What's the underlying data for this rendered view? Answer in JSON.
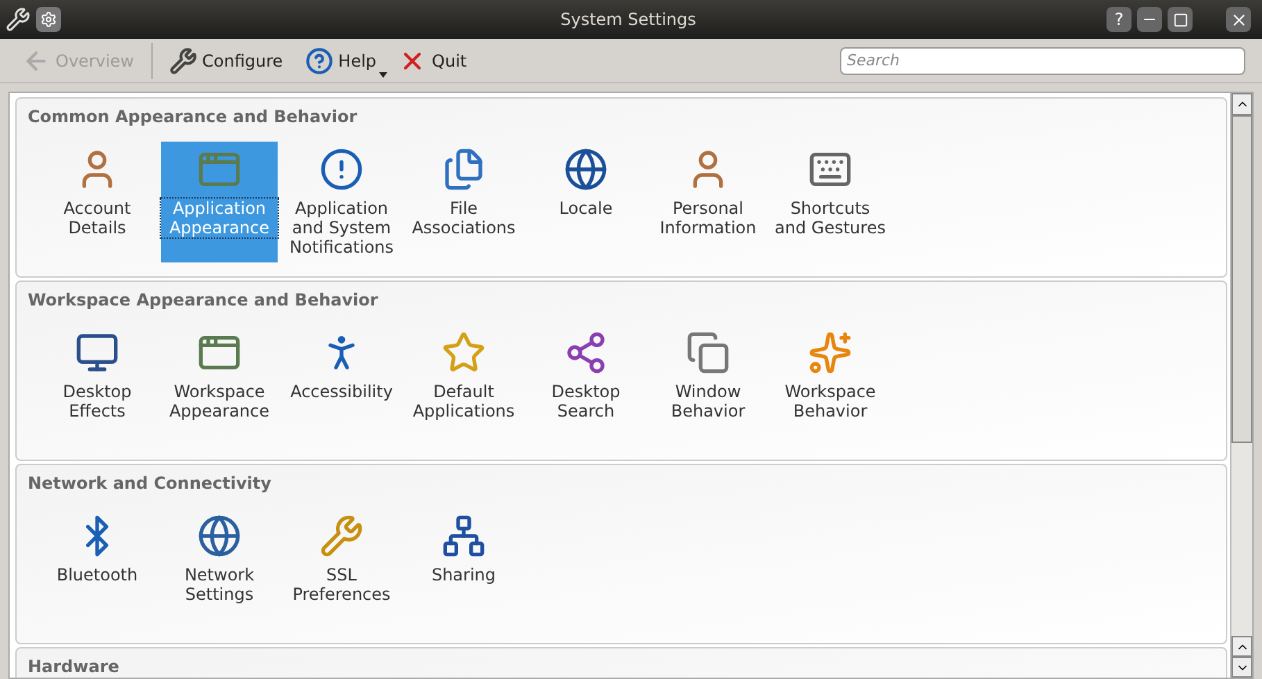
{
  "window": {
    "title": "System Settings",
    "help_button": "?"
  },
  "toolbar": [
    {
      "label": "Overview",
      "disabled": true,
      "menu": false
    },
    {
      "label": "Configure",
      "disabled": false,
      "menu": false
    },
    {
      "label": "Help",
      "disabled": false,
      "menu": true
    },
    {
      "label": "Quit",
      "disabled": false,
      "menu": false
    }
  ],
  "search": {
    "placeholder": "Search"
  },
  "sections": [
    {
      "title": "Common Appearance and Behavior",
      "items": [
        {
          "label": "Account Details",
          "selected": false
        },
        {
          "label": "Application Appearance",
          "selected": true
        },
        {
          "label": "Application and System Notifications",
          "selected": false
        },
        {
          "label": "File Associations",
          "selected": false
        },
        {
          "label": "Locale",
          "selected": false
        },
        {
          "label": "Personal Information",
          "selected": false
        },
        {
          "label": "Shortcuts and Gestures",
          "selected": false
        }
      ]
    },
    {
      "title": "Workspace Appearance and Behavior",
      "items": [
        {
          "label": "Desktop Effects",
          "selected": false
        },
        {
          "label": "Workspace Appearance",
          "selected": false
        },
        {
          "label": "Accessibility",
          "selected": false
        },
        {
          "label": "Default Applications",
          "selected": false
        },
        {
          "label": "Desktop Search",
          "selected": false
        },
        {
          "label": "Window Behavior",
          "selected": false
        },
        {
          "label": "Workspace Behavior",
          "selected": false
        }
      ]
    },
    {
      "title": "Network and Connectivity",
      "items": [
        {
          "label": "Bluetooth",
          "selected": false
        },
        {
          "label": "Network Settings",
          "selected": false
        },
        {
          "label": "SSL Preferences",
          "selected": false
        },
        {
          "label": "Sharing",
          "selected": false
        }
      ]
    },
    {
      "title": "Hardware"
    }
  ]
}
